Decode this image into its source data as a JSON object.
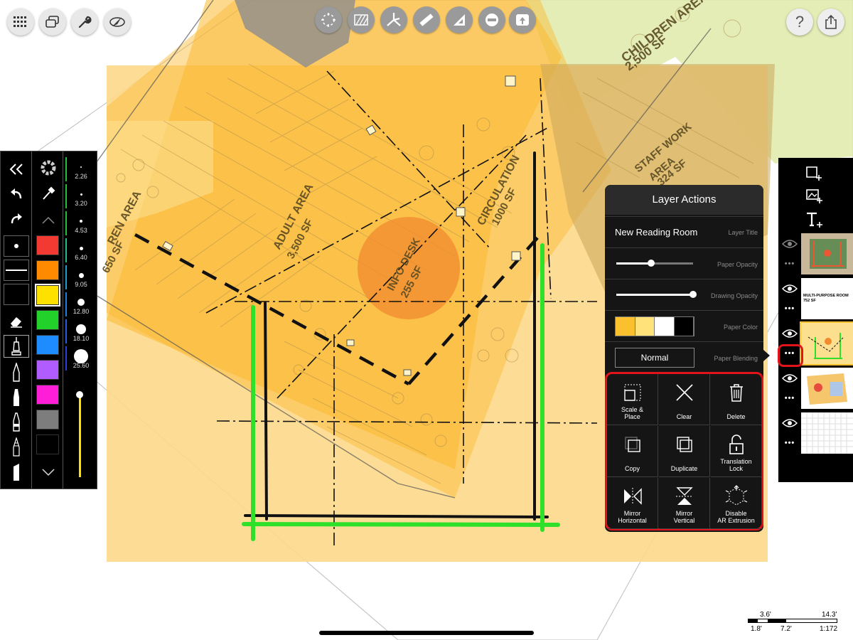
{
  "toolbar": {
    "left_icons": [
      "grid-dots-icon",
      "windows-icon",
      "wrench-icon",
      "compass-icon"
    ],
    "center_icons": [
      "select-move-icon",
      "hatch-icon",
      "tripod-icon",
      "ruler-icon",
      "triangle-icon",
      "minus-circle-icon",
      "photo-stamp-icon"
    ],
    "help_label": "?",
    "share_icon": "share-icon"
  },
  "plan_labels": {
    "children_area": "CHILDREN AREA",
    "children_sf": "2,500 SF",
    "staff_work": "STAFF WORK",
    "staff_area": "AREA",
    "staff_sf": "324 SF",
    "adult_area": "ADULT AREA",
    "adult_sf": "3,500 SF",
    "circulation": "CIRCULATION",
    "circulation_sf": "1000 SF",
    "info_desk": "INFO DESK",
    "info_sf": "255 SF",
    "left_area": "REN AREA",
    "left_sf": "650 SF"
  },
  "palette": {
    "colors": [
      "#f23a32",
      "#ff8a00",
      "#ffe100",
      "#22d22a",
      "#1e8cff",
      "#b05cff",
      "#ff1ed8",
      "#7d7d7d",
      "#000000"
    ],
    "sizes": [
      "2.26",
      "3.20",
      "4.53",
      "6.40",
      "9.05",
      "12.80",
      "18.10",
      "25.60"
    ],
    "selected_color": "#ffe100"
  },
  "layer_actions": {
    "title": "Layer Actions",
    "layer_title_value": "New Reading Room",
    "layer_title_caption": "Layer Title",
    "paper_opacity_caption": "Paper Opacity",
    "paper_opacity_value": 0.45,
    "drawing_opacity_caption": "Drawing Opacity",
    "drawing_opacity_value": 1.0,
    "paper_color_caption": "Paper Color",
    "paper_colors": [
      "#fbc02d",
      "#ffe27a",
      "#ffffff",
      "#000000"
    ],
    "blending_value": "Normal",
    "blending_caption": "Paper Blending",
    "actions": [
      {
        "label1": "Scale &",
        "label2": "Place",
        "icon": "scale-place-icon"
      },
      {
        "label1": "Clear",
        "label2": "",
        "icon": "clear-x-icon"
      },
      {
        "label1": "Delete",
        "label2": "",
        "icon": "trash-icon"
      },
      {
        "label1": "Copy",
        "label2": "",
        "icon": "copy-icon"
      },
      {
        "label1": "Duplicate",
        "label2": "",
        "icon": "duplicate-icon"
      },
      {
        "label1": "Translation",
        "label2": "Lock",
        "icon": "unlock-icon"
      },
      {
        "label1": "Mirror",
        "label2": "Horizontal",
        "icon": "mirror-horizontal-icon"
      },
      {
        "label1": "Mirror",
        "label2": "Vertical",
        "icon": "mirror-vertical-icon"
      },
      {
        "label1": "Disable",
        "label2": "AR Extrusion",
        "icon": "ar-extrusion-icon"
      }
    ]
  },
  "layers_panel": {
    "tools": [
      "new-layer-icon",
      "image-layer-icon",
      "text-layer-icon"
    ],
    "layers": [
      {
        "thumb_text": ""
      },
      {
        "thumb_text": "MULTI-PURPOSE ROOM 752 SF"
      },
      {
        "thumb_text": ""
      },
      {
        "thumb_text": ""
      },
      {
        "thumb_text": ""
      }
    ],
    "dots": "•••"
  },
  "scale_bar": {
    "top_left": "3.6'",
    "top_right": "14.3'",
    "bottom_1": "1.8'",
    "bottom_2": "7.2'",
    "ratio": "1:172"
  }
}
